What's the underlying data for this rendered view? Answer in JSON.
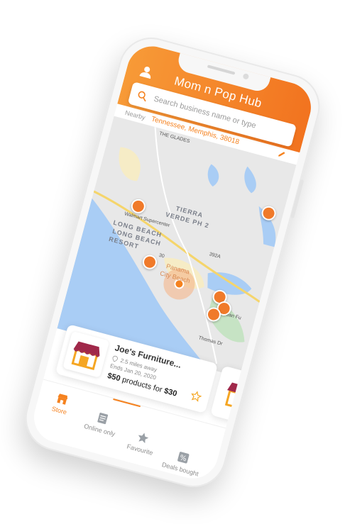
{
  "app": {
    "title": "Mom n Pop Hub"
  },
  "search": {
    "placeholder": "Search business name or type"
  },
  "location": {
    "prefix": "Nearby",
    "value": "Tennessee, Memphis, 38018"
  },
  "map": {
    "labels": {
      "area1": "TIERRA",
      "area1b": "VERDE PH 2",
      "area2": "LONG BEACH",
      "area2b": "LONG BEACH",
      "area2c": "RESORT",
      "city1": "Panama",
      "city1b": "City Beach",
      "store": "Walmart Supercenter",
      "road1": "Thomas Dr",
      "road2": "392A",
      "road3": "30",
      "top": "THE GLADES",
      "beach": "Ocean Fu"
    }
  },
  "store_card": {
    "name": "Joe's  Furniture...",
    "distance": "2.5 miles away",
    "ends": "Ends Jan 20, 2020",
    "deal_amount": "$50",
    "deal_mid": " products for ",
    "deal_price": "$30"
  },
  "nav": {
    "items": [
      {
        "label": "Store",
        "icon": "store-icon"
      },
      {
        "label": "Online only",
        "icon": "newspaper-icon"
      },
      {
        "label": "Favourite",
        "icon": "star-icon"
      },
      {
        "label": "Deals bought",
        "icon": "discount-tag-icon"
      }
    ],
    "active": "Store"
  },
  "colors": {
    "accent": "#f5821f",
    "accent_light": "#f79a37",
    "water": "#a9cdf5",
    "land": "#e8e8e8",
    "park": "#c6e3c4"
  }
}
